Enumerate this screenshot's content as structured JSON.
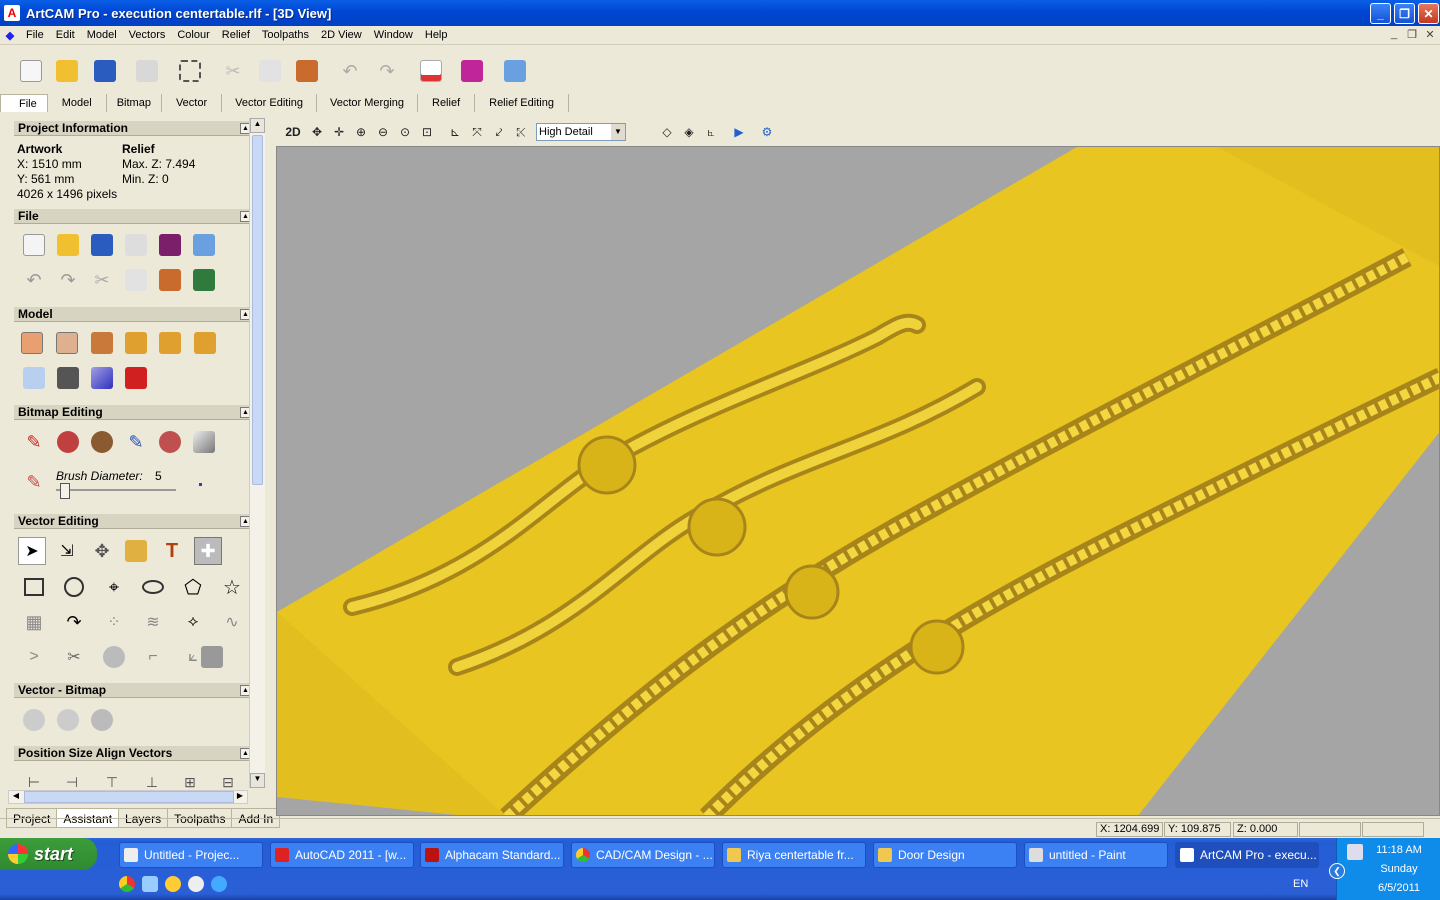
{
  "window": {
    "title": "ArtCAM Pro - execution centertable.rlf - [3D View]",
    "app_icon": "A"
  },
  "menu": [
    "File",
    "Edit",
    "Model",
    "Vectors",
    "Colour",
    "Relief",
    "Toolpaths",
    "2D View",
    "Window",
    "Help"
  ],
  "ribbon_tabs": [
    "File",
    "Model",
    "Bitmap",
    "Vector",
    "Vector Editing",
    "Vector Merging",
    "Relief",
    "Relief Editing"
  ],
  "active_ribbon_tab": "File",
  "panel": {
    "project_info": {
      "title": "Project Information",
      "artwork_label": "Artwork",
      "relief_label": "Relief",
      "x": "X: 1510 mm",
      "y": "Y: 561 mm",
      "pixels": "4026 x 1496 pixels",
      "maxz": "Max. Z: 7.494",
      "minz": "Min. Z: 0"
    },
    "file_title": "File",
    "model_title": "Model",
    "bitmap_title": "Bitmap Editing",
    "brush": {
      "label": "Brush Diameter:",
      "value": "5"
    },
    "vector_title": "Vector Editing",
    "vectorbitmap_title": "Vector - Bitmap",
    "position_title": "Position Size Align Vectors"
  },
  "bottom_tabs": [
    "Project",
    "Assistant",
    "Layers",
    "Toolpaths",
    "Add In"
  ],
  "active_bottom_tab": "Assistant",
  "view_toolbar": {
    "mode": "2D",
    "detail": "High Detail"
  },
  "status": {
    "x": "X: 1204.699",
    "y": "Y: 109.875",
    "z": "Z: 0.000"
  },
  "taskbar": {
    "start": "start",
    "tasks": [
      "Untitled - Projec...",
      "AutoCAD 2011 - [w...",
      "Alphacam Standard...",
      "CAD/CAM Design - ...",
      "Riya centertable fr...",
      "Door Design",
      "untitled - Paint",
      "ArtCAM Pro - execu..."
    ],
    "active_task": "ArtCAM Pro - execu...",
    "lang": "EN",
    "time": "11:18 AM",
    "day": "Sunday",
    "date": "6/5/2011"
  },
  "colors": {
    "relief": "#e6c21e",
    "view_bg": "#a5a5a5",
    "taskbar": "#245ed6"
  }
}
